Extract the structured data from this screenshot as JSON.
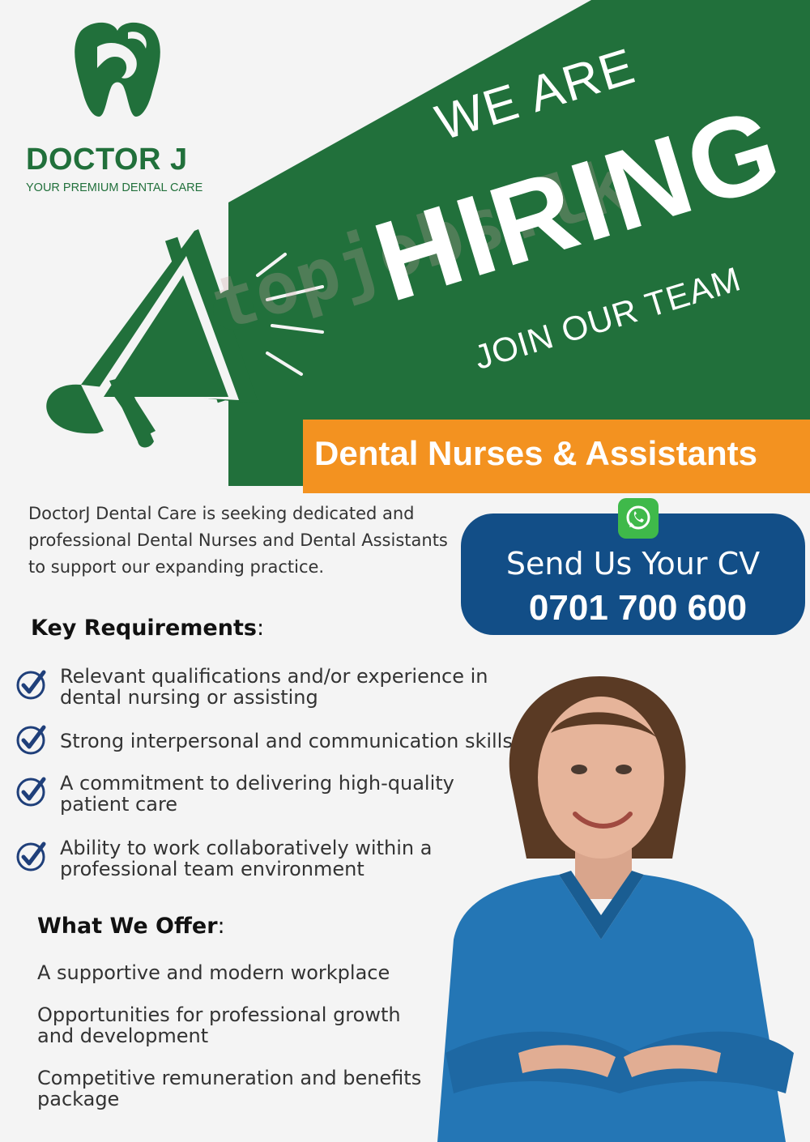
{
  "brand": {
    "name": "DOCTOR J",
    "tagline": "YOUR PREMIUM DENTAL CARE"
  },
  "banner": {
    "line1": "WE ARE",
    "line2": "HIRING",
    "line3": "JOIN OUR TEAM",
    "watermark": "topjobs.lk"
  },
  "position": {
    "title": "Dental Nurses & Assistants"
  },
  "intro": {
    "text": "DoctorJ Dental Care is seeking dedicated and professional Dental Nurses and Dental Assistants to support our expanding practice."
  },
  "contact": {
    "label": "Send Us Your CV",
    "phone": "0701 700 600",
    "icon": "whatsapp-icon"
  },
  "requirements": {
    "heading": "Key Requirements",
    "colon": ":",
    "items": [
      {
        "line1": "Relevant qualifications and/or experience in",
        "line2": "dental nursing or assisting"
      },
      {
        "line1": "Strong interpersonal and communication skills",
        "line2": ""
      },
      {
        "line1": "A commitment to delivering high-quality",
        "line2": "patient care"
      },
      {
        "line1": "Ability to work collaboratively within a",
        "line2": "professional team environment"
      }
    ]
  },
  "offer": {
    "heading": "What We Offer",
    "colon": ":",
    "items": [
      {
        "line1": "A supportive and modern workplace",
        "line2": ""
      },
      {
        "line1": "Opportunities for professional growth",
        "line2": "and development"
      },
      {
        "line1": "Competitive remuneration and benefits",
        "line2": "package"
      }
    ]
  },
  "colors": {
    "green": "#21703b",
    "orange": "#f39220",
    "navy": "#124e87",
    "check": "#1f3f7a"
  }
}
